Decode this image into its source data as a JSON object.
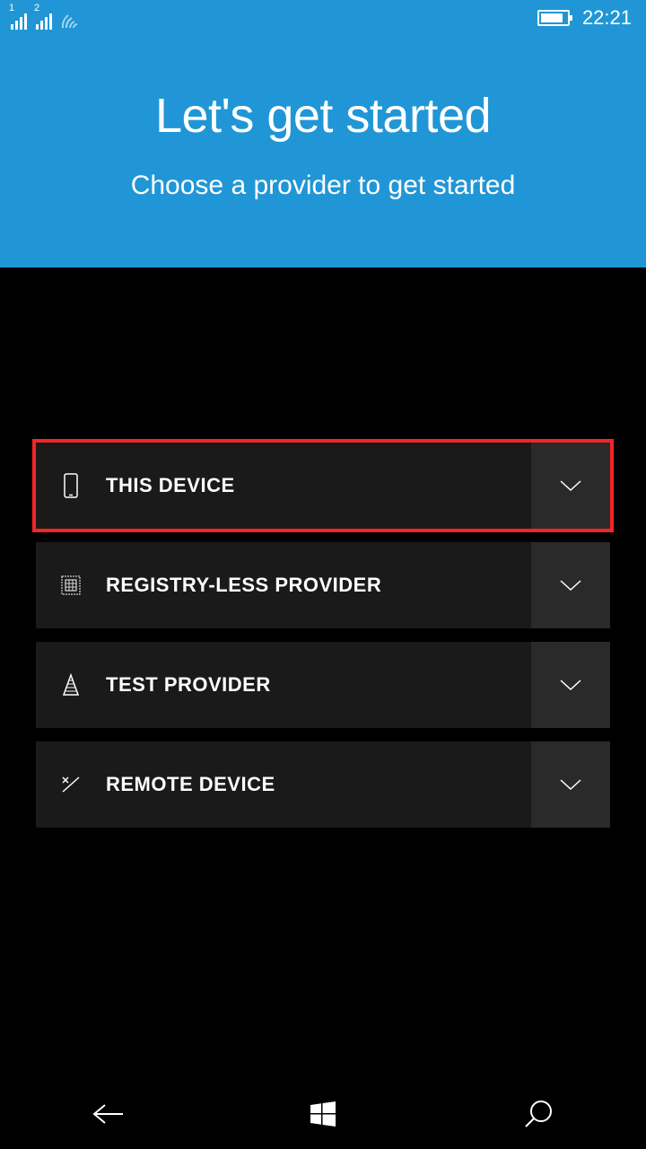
{
  "status": {
    "sim1": "1",
    "sim2": "2",
    "time": "22:21"
  },
  "header": {
    "title": "Let's get started",
    "subtitle": "Choose a provider to get started"
  },
  "providers": [
    {
      "label": "THIS DEVICE",
      "highlighted": true
    },
    {
      "label": "REGISTRY-LESS PROVIDER",
      "highlighted": false
    },
    {
      "label": "TEST PROVIDER",
      "highlighted": false
    },
    {
      "label": "REMOTE DEVICE",
      "highlighted": false
    }
  ]
}
